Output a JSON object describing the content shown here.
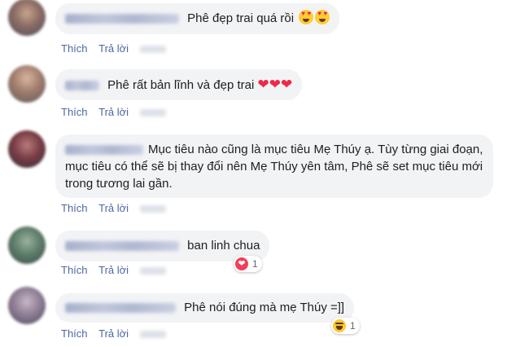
{
  "actions": {
    "like_label": "Thích",
    "reply_label": "Trả lời"
  },
  "comments": [
    {
      "text": "Phê đẹp trai quá rồi",
      "emoji": "heart-eyes-face x2"
    },
    {
      "text": "Phê rất bản lĩnh và đẹp trai",
      "emoji": "red-heart x3"
    },
    {
      "text": "Mục tiêu nào cũng là mục tiêu Mẹ Thúy ạ. Tùy từng giai đoạn, mục tiêu có thể sẽ bị thay đổi nên Mẹ Thúy yên tâm, Phê sẽ set mục tiêu mới trong tương lai gần."
    },
    {
      "text": "ban linh chua",
      "reaction_count": "1",
      "reaction_icon": "love-reaction-icon"
    },
    {
      "text": "Phê nói đúng mà mẹ Thúy =]]",
      "reaction_count": "1",
      "reaction_icon": "haha-reaction-icon"
    }
  ],
  "colors": {
    "bubble": "#f2f3f5",
    "action_link": "#4b67a1",
    "text": "#1c1e21"
  }
}
